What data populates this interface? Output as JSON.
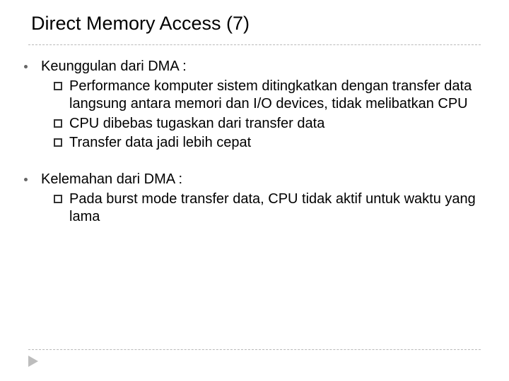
{
  "title": "Direct Memory Access (7)",
  "sections": [
    {
      "heading": "Keunggulan dari DMA :",
      "items": [
        "Performance komputer sistem ditingkatkan dengan transfer data langsung antara memori dan I/O devices, tidak melibatkan CPU",
        "CPU dibebas tugaskan dari transfer data",
        "Transfer data jadi lebih cepat"
      ]
    },
    {
      "heading": "Kelemahan dari DMA :",
      "items": [
        "Pada burst mode transfer data, CPU tidak aktif untuk waktu yang lama"
      ]
    }
  ]
}
